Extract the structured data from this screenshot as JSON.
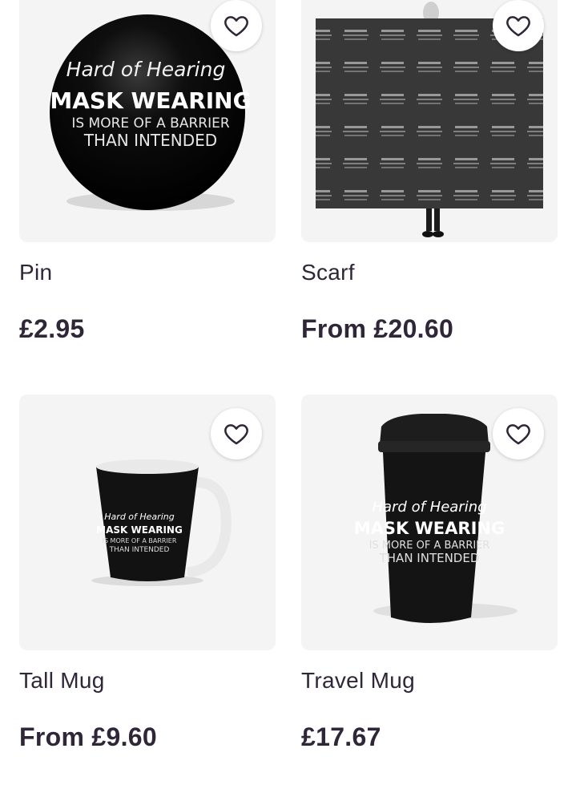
{
  "products": [
    {
      "id": "pin",
      "name": "Pin",
      "price": "£2.95",
      "artwork": {
        "line1": "Hard of Hearing",
        "line2": "MASK WEARING",
        "line3": "IS MORE OF A BARRIER",
        "line4": "THAN INTENDED"
      }
    },
    {
      "id": "scarf",
      "name": "Scarf",
      "price": "From £20.60"
    },
    {
      "id": "tallmug",
      "name": "Tall Mug",
      "price": "From £9.60",
      "artwork": {
        "line1": "Hard of Hearing",
        "line2": "MASK WEARING",
        "line3": "IS MORE OF A BARRIER",
        "line4": "THAN INTENDED"
      }
    },
    {
      "id": "travelmug",
      "name": "Travel Mug",
      "price": "£17.67",
      "artwork": {
        "line1": "Hard of Hearing",
        "line2": "MASK WEARING",
        "line3": "IS MORE OF A BARRIER",
        "line4": "THAN INTENDED"
      }
    }
  ],
  "icons": {
    "favorite": "heart-outline-icon"
  },
  "colors": {
    "text": "#2f2638",
    "thumb_bg": "#f4f4f4",
    "product_black": "#111111"
  }
}
